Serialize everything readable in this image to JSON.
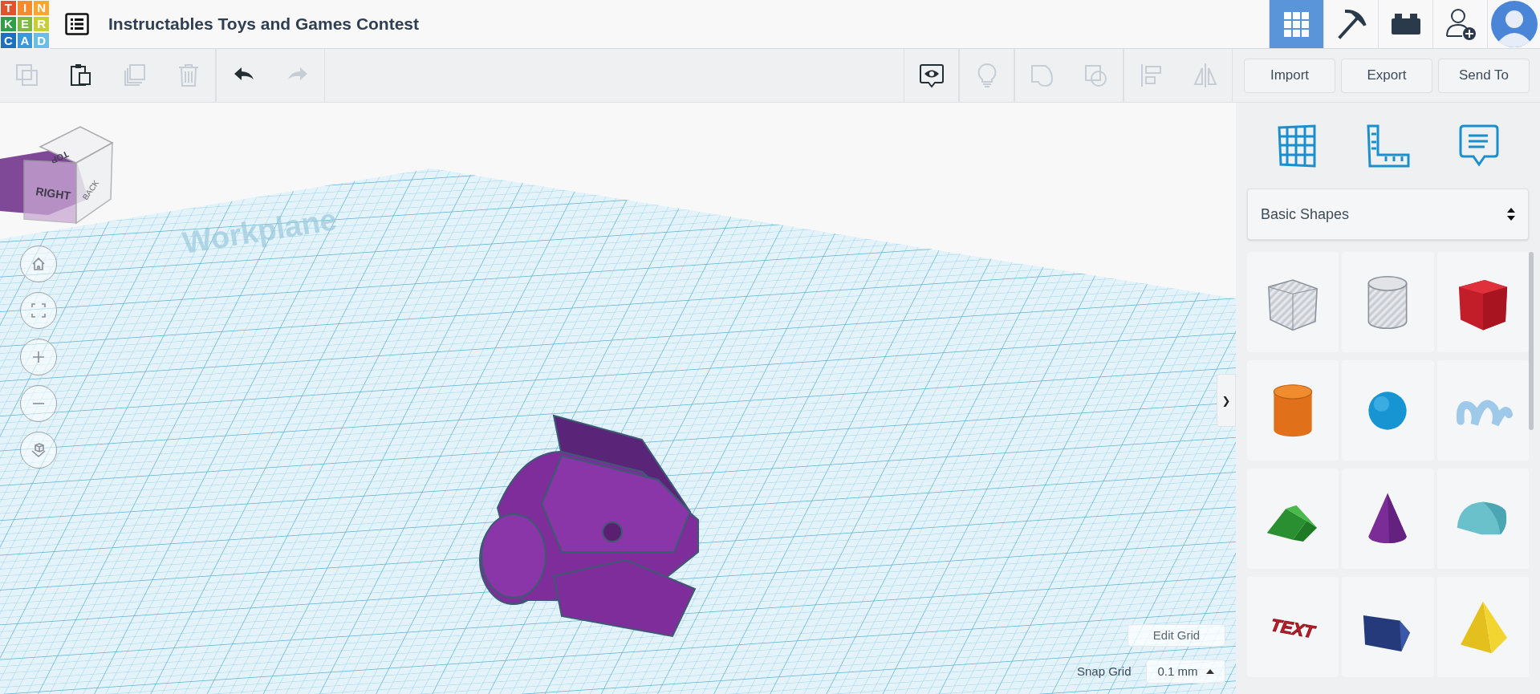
{
  "header": {
    "logo": [
      "T",
      "I",
      "N",
      "K",
      "E",
      "R",
      "C",
      "A",
      "D"
    ],
    "title": "Instructables Toys and Games Contest",
    "nav": [
      {
        "kind": "grid",
        "selected": true
      },
      {
        "kind": "pickaxe",
        "selected": false
      },
      {
        "kind": "brick",
        "selected": false
      },
      {
        "kind": "add-user",
        "selected": false
      }
    ]
  },
  "toolbar": {
    "left_groups": [
      [
        {
          "kind": "copy",
          "disabled": true
        },
        {
          "kind": "paste",
          "disabled": false
        },
        {
          "kind": "duplicate",
          "disabled": true
        },
        {
          "kind": "delete",
          "disabled": true
        }
      ],
      [
        {
          "kind": "undo",
          "disabled": false
        },
        {
          "kind": "redo",
          "disabled": true
        }
      ]
    ],
    "right_groups": [
      [
        {
          "kind": "notes",
          "disabled": false
        }
      ],
      [
        {
          "kind": "bulb",
          "disabled": true
        }
      ],
      [
        {
          "kind": "group",
          "disabled": true
        },
        {
          "kind": "subtract",
          "disabled": true
        }
      ],
      [
        {
          "kind": "align",
          "disabled": true
        },
        {
          "kind": "mirror",
          "disabled": true
        }
      ]
    ],
    "buttons": [
      "Import",
      "Export",
      "Send To"
    ]
  },
  "canvas": {
    "view_cube": {
      "top": "TOP",
      "right": "RIGHT",
      "back": "BACK"
    },
    "workplane_label": "Workplane",
    "nav_controls": [
      {
        "kind": "home"
      },
      {
        "kind": "fit"
      },
      {
        "kind": "zoom-in"
      },
      {
        "kind": "zoom-out"
      },
      {
        "kind": "ortho"
      }
    ],
    "edit_grid": "Edit Grid",
    "snap_grid": {
      "label": "Snap Grid",
      "value": "0.1 mm"
    },
    "panel_toggle": "❯"
  },
  "panel": {
    "views": [
      {
        "kind": "grid"
      },
      {
        "kind": "ruler"
      },
      {
        "kind": "notes"
      }
    ],
    "library": "Basic Shapes",
    "shapes": [
      {
        "kind": "box-hole"
      },
      {
        "kind": "cylinder-hole"
      },
      {
        "kind": "box"
      },
      {
        "kind": "cylinder"
      },
      {
        "kind": "sphere"
      },
      {
        "kind": "scribble"
      },
      {
        "kind": "roof"
      },
      {
        "kind": "cone"
      },
      {
        "kind": "round-roof"
      },
      {
        "kind": "text",
        "text": "TEXT"
      },
      {
        "kind": "polygon"
      },
      {
        "kind": "pyramid"
      }
    ]
  }
}
